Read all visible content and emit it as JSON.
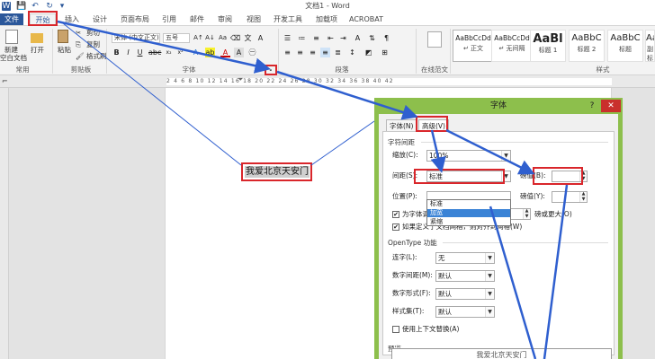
{
  "window": {
    "title": "文档1 - Word",
    "qa_icons": [
      "W",
      "💾",
      "↶",
      "↻",
      "▾"
    ]
  },
  "tabs": [
    {
      "label": "文件",
      "type": "file"
    },
    {
      "label": "开始",
      "type": "active"
    },
    {
      "label": "插入",
      "type": ""
    },
    {
      "label": "设计",
      "type": ""
    },
    {
      "label": "页面布局",
      "type": ""
    },
    {
      "label": "引用",
      "type": ""
    },
    {
      "label": "邮件",
      "type": ""
    },
    {
      "label": "审阅",
      "type": ""
    },
    {
      "label": "视图",
      "type": ""
    },
    {
      "label": "开发工具",
      "type": ""
    },
    {
      "label": "加载项",
      "type": ""
    },
    {
      "label": "ACROBAT",
      "type": ""
    }
  ],
  "ribbon": {
    "new_label": "新建",
    "new_sub": "空白文档",
    "open_label": "打开",
    "paste_label": "粘贴",
    "cut_label": "剪切",
    "copy_label": "复制",
    "painter_label": "格式刷",
    "font_name": "宋体 (中文正文)",
    "font_size": "五号",
    "groups": {
      "common": "常用",
      "clipboard": "剪贴板",
      "font": "字体",
      "paragraph": "段落",
      "online": "在线范文",
      "styles": "样式"
    },
    "styles": [
      {
        "sample": "AaBbCcDd",
        "name": "↵ 正文",
        "big": false
      },
      {
        "sample": "AaBbCcDd",
        "name": "↵ 无间隔",
        "big": false
      },
      {
        "sample": "AaBl",
        "name": "标题 1",
        "big": true
      },
      {
        "sample": "AaBbC",
        "name": "标题 2",
        "big": false
      },
      {
        "sample": "AaBbC",
        "name": "标题",
        "big": false
      },
      {
        "sample": "AaBbC",
        "name": "副标题",
        "big": false
      }
    ]
  },
  "ruler": {
    "numbers": "2 4 6 8 10 12 14 16 18 20 22 24 26 28 30 32 34 36 38 40 42"
  },
  "document": {
    "selected_text": "我爱北京天安门"
  },
  "dialog": {
    "title": "字体",
    "help": "?",
    "close": "✕",
    "tabs": [
      "字体(N)",
      "高级(V)"
    ],
    "char_spacing_section": "字符间距",
    "scale_label": "缩放(C):",
    "scale_value": "100%",
    "spacing_label": "间距(S):",
    "spacing_value": "标准",
    "spacing_options": [
      "标准",
      "加宽",
      "紧缩"
    ],
    "spacing_highlight": 1,
    "pound1_label": "磅值(B):",
    "pound1_value": "",
    "position_label": "位置(P):",
    "position_value": "",
    "pound2_label": "磅值(Y):",
    "kern_label": "为字体调整字间距(K):",
    "kern_suffix": "磅或更大(O)",
    "grid_label": "如果定义了文档网格，则对齐到网格(W)",
    "opentype_section": "OpenType 功能",
    "ligature_label": "连字(L):",
    "ligature_value": "无",
    "numspacing_label": "数字间距(M):",
    "numspacing_value": "默认",
    "numform_label": "数字形式(F):",
    "numform_value": "默认",
    "styleset_label": "样式集(T):",
    "styleset_value": "默认",
    "contextual_label": "使用上下文替换(A)",
    "preview_section": "预览",
    "preview_text": "我爱北京天安门"
  }
}
